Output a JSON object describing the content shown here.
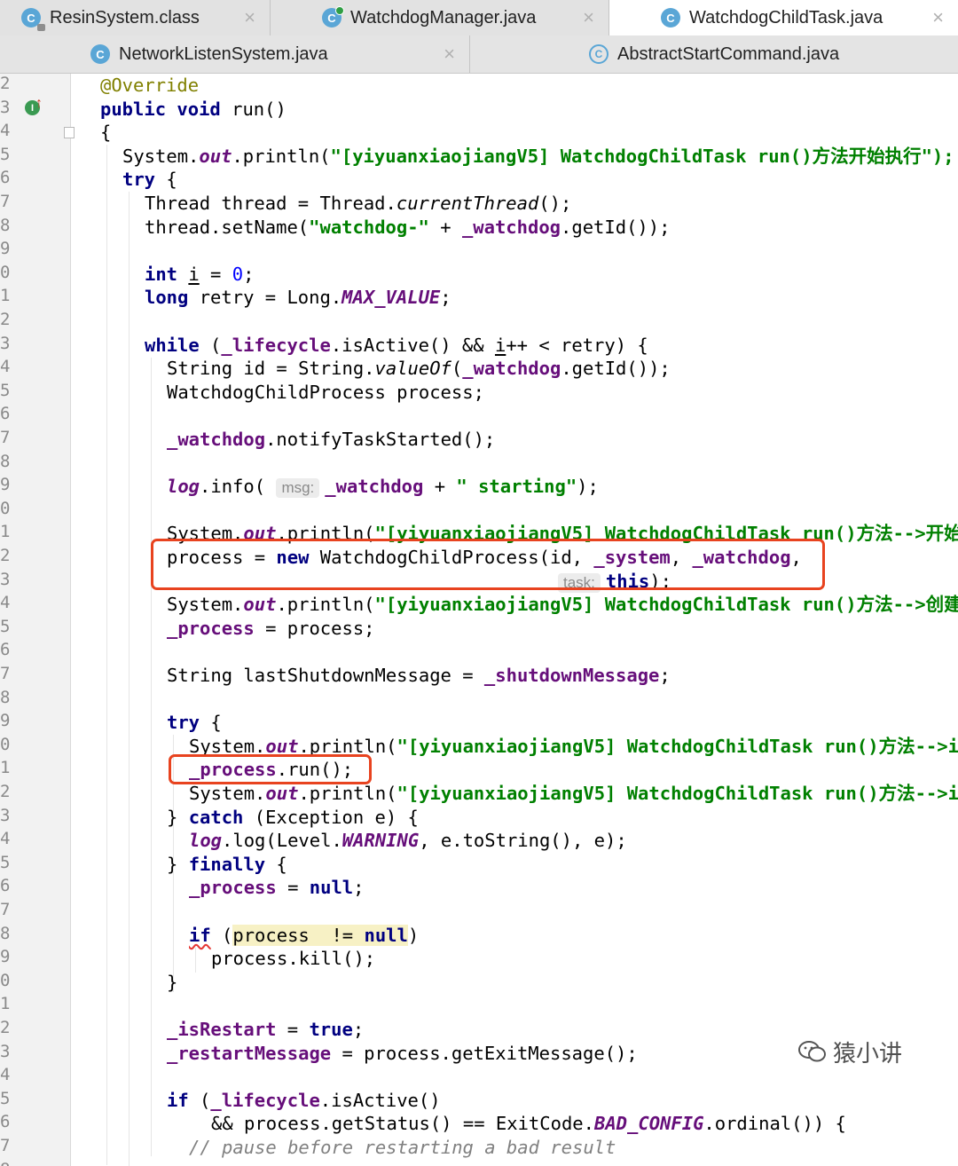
{
  "tabs_row1": [
    {
      "label": "ResinSystem.class",
      "icon": "class-locked-icon",
      "active": false,
      "closable": true
    },
    {
      "label": "WatchdogManager.java",
      "icon": "class-icon",
      "active": false,
      "closable": true
    },
    {
      "label": "WatchdogChildTask.java",
      "icon": "class-icon",
      "active": true,
      "closable": true
    }
  ],
  "tabs_row2": [
    {
      "label": "NetworkListenSystem.java",
      "icon": "class-icon",
      "closable": true
    },
    {
      "label": "AbstractStartCommand.java",
      "icon": "abstract-class-icon",
      "closable": false
    }
  ],
  "icon_letter": "C",
  "close_glyph": "×",
  "gutter_digits": [
    "2",
    "3",
    "4",
    "5",
    "6",
    "7",
    "8",
    "9",
    "0",
    "1",
    "2",
    "3",
    "4",
    "5",
    "6",
    "7",
    "8",
    "9",
    "0",
    "1",
    "2",
    "3",
    "4",
    "5",
    "6",
    "7",
    "8",
    "9",
    "0",
    "1",
    "2",
    "3",
    "4",
    "5",
    "6",
    "7",
    "8",
    "9",
    "0",
    "1",
    "2",
    "3",
    "4",
    "5",
    "6",
    "7",
    "8"
  ],
  "gutter_override_letter": "I",
  "gutter_override_arrow": "↑",
  "code": {
    "l1_annotation": "@Override",
    "l2_public": "public",
    "l2_void": "void",
    "l2_rest": " run()",
    "l3": "{",
    "l4_a": "System.",
    "l4_out": "out",
    "l4_b": ".println(",
    "l4_str": "\"[yiyuanxiaojiangV5] WatchdogChildTask run()方法开始执行\");",
    "l5_try": "try",
    "l5_rest": " {",
    "l6_a": "Thread thread = Thread.",
    "l6_call": "currentThread",
    "l6_b": "();",
    "l7_a": "thread.setName(",
    "l7_str": "\"watchdog-\"",
    "l7_b": " + ",
    "l7_fld": "_watchdog",
    "l7_c": ".getId());",
    "l9_int": "int",
    "l9_var": "i",
    "l9_eq": " = ",
    "l9_num": "0",
    "l9_semi": ";",
    "l10_long": "long",
    "l10_a": " retry = Long.",
    "l10_const": "MAX_VALUE",
    "l10_semi": ";",
    "l12_while": "while",
    "l12_a": " (",
    "l12_fld": "_lifecycle",
    "l12_b": ".isActive() && ",
    "l12_var": "i",
    "l12_c": "++ < retry) {",
    "l13_a": "String id = String.",
    "l13_call": "valueOf",
    "l13_b": "(",
    "l13_fld": "_watchdog",
    "l13_c": ".getId());",
    "l14": "WatchdogChildProcess process;",
    "l16_fld": "_watchdog",
    "l16_rest": ".notifyTaskStarted();",
    "l18_log": "log",
    "l18_a": ".info( ",
    "l18_hint": "msg:",
    "l18_fld": "_watchdog",
    "l18_b": " + ",
    "l18_str": "\" starting\"",
    "l18_c": ");",
    "l20_a": "System.",
    "l20_out": "out",
    "l20_b": ".println(",
    "l20_str": "\"[yiyuanxiaojiangV5] WatchdogChildTask run()方法-->开始",
    "l21_a": "process = ",
    "l21_new": "new",
    "l21_b": " WatchdogChildProcess(id, ",
    "l21_sys": "_system",
    "l21_c": ", ",
    "l21_wd": "_watchdog",
    "l21_d": ",",
    "l22_hint": "task:",
    "l22_this": "this",
    "l22_rest": ");",
    "l23_a": "System.",
    "l23_out": "out",
    "l23_b": ".println(",
    "l23_str": "\"[yiyuanxiaojiangV5] WatchdogChildTask run()方法-->创建",
    "l24_fld": "_process",
    "l24_rest": " = process;",
    "l26_a": "String lastShutdownMessage = ",
    "l26_fld": "_shutdownMessage",
    "l26_semi": ";",
    "l28_try": "try",
    "l28_rest": " {",
    "l29_a": "System.",
    "l29_out": "out",
    "l29_b": ".println(",
    "l29_str": "\"[yiyuanxiaojiangV5] WatchdogChildTask run()方法-->i",
    "l30_fld": "_process",
    "l30_rest": ".run();",
    "l31_a": "System.",
    "l31_out": "out",
    "l31_b": ".println(",
    "l31_str": "\"[yiyuanxiaojiangV5] WatchdogChildTask run()方法-->i",
    "l32_a": "} ",
    "l32_catch": "catch",
    "l32_b": " (Exception e) {",
    "l33_log": "log",
    "l33_a": ".log(Level.",
    "l33_const": "WARNING",
    "l33_b": ", e.toString(), e);",
    "l34_a": "} ",
    "l34_finally": "finally",
    "l34_b": " {",
    "l35_fld": "_process",
    "l35_a": " = ",
    "l35_null": "null",
    "l35_semi": ";",
    "l37_if": "if",
    "l37_a": " (",
    "l37_hl": "process  != ",
    "l37_null": "null",
    "l37_b": ")",
    "l38": "process.kill();",
    "l39": "}",
    "l41_fld": "_isRestart",
    "l41_a": " = ",
    "l41_true": "true",
    "l41_semi": ";",
    "l42_fld": "_restartMessage",
    "l42_rest": " = process.getExitMessage();",
    "l44_if": "if",
    "l44_a": " (",
    "l44_fld": "_lifecycle",
    "l44_b": ".isActive()",
    "l45_a": "&& process.getStatus() == ExitCode.",
    "l45_const": "BAD_CONFIG",
    "l45_b": ".ordinal()) {",
    "l46_cmt": "// pause before restarting a bad result"
  },
  "watermark_text": "猿小讲",
  "highlight_color": "#e8431f"
}
